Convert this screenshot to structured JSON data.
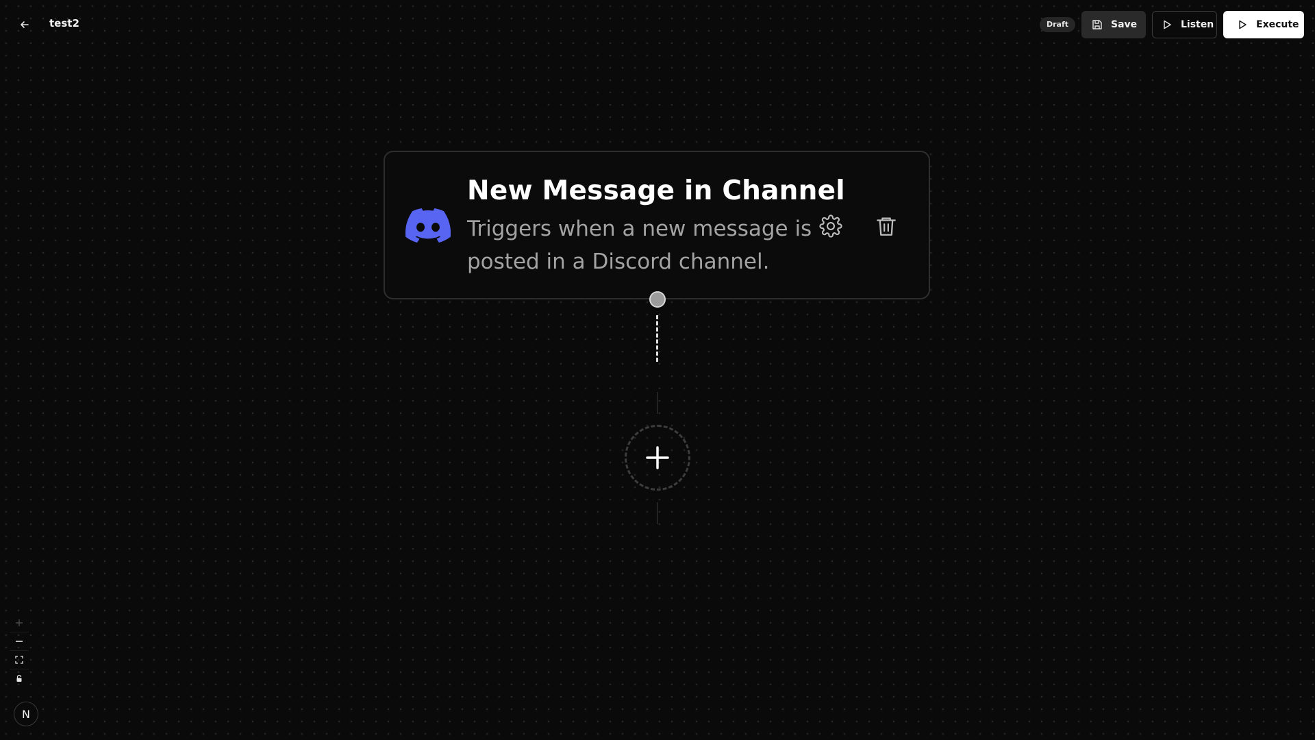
{
  "header": {
    "title": "test2",
    "status_badge": "Draft",
    "save_label": "Save",
    "listen_label": "Listen",
    "execute_label": "Execute"
  },
  "node": {
    "title": "New Message in Channel",
    "description": "Triggers when a new message is posted in a Discord channel.",
    "icon": "discord-icon",
    "brand_color": "#5865F2"
  },
  "controls": {
    "icons": [
      "zoom-in-icon",
      "zoom-out-icon",
      "fit-view-icon",
      "lock-icon"
    ]
  },
  "logo": {
    "letter": "N"
  }
}
